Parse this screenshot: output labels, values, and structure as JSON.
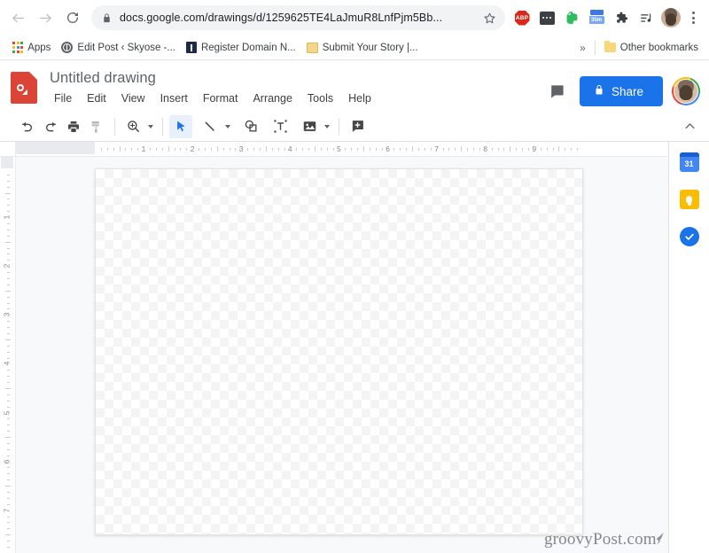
{
  "browser": {
    "nav": {
      "back_label": "Back",
      "forward_label": "Forward",
      "reload_label": "Reload"
    },
    "omnibox": {
      "url": "docs.google.com/drawings/d/1259625TE4LaJmuR8LnfPjm5Bb...",
      "lock_label": "Secure",
      "star_label": "Bookmark this tab"
    },
    "extensions": [
      {
        "name": "adblock-plus-extension",
        "label": "ABP"
      },
      {
        "name": "dots-extension",
        "label": ""
      },
      {
        "name": "evernote-extension",
        "label": ""
      },
      {
        "name": "timer-extension",
        "label": "35m"
      },
      {
        "name": "extensions-puzzle",
        "label": ""
      },
      {
        "name": "media-playlist",
        "label": ""
      }
    ],
    "profile_label": "Profile",
    "menu_label": "Customize and control Google Chrome",
    "bookmarks": [
      {
        "name": "bookmark-apps",
        "label": "Apps",
        "icon": "apps-grid-icon"
      },
      {
        "name": "bookmark-edit-post",
        "label": "Edit Post ‹ Skyose -...",
        "icon": "globe-icon"
      },
      {
        "name": "bookmark-register-domain",
        "label": "Register Domain N...",
        "icon": "blue-square-icon"
      },
      {
        "name": "bookmark-submit-story",
        "label": "Submit Your Story |...",
        "icon": "yellow-page-icon"
      }
    ],
    "overflow_label": "»",
    "other_bookmarks_label": "Other bookmarks"
  },
  "app": {
    "doc_icon_name": "google-drawings-icon",
    "title": "Untitled drawing",
    "menus": [
      "File",
      "Edit",
      "View",
      "Insert",
      "Format",
      "Arrange",
      "Tools",
      "Help"
    ],
    "comment_label": "Open comment history",
    "share_label": "Share",
    "share_color": "#1a73e8",
    "avatar_label": "Google Account",
    "toolbar": [
      {
        "name": "undo-button",
        "icon": "undo-icon",
        "state": "enabled",
        "caret": false
      },
      {
        "name": "redo-button",
        "icon": "redo-icon",
        "state": "enabled",
        "caret": false
      },
      {
        "name": "print-button",
        "icon": "print-icon",
        "state": "enabled",
        "caret": false
      },
      {
        "name": "paint-format-button",
        "icon": "paint-format-icon",
        "state": "disabled",
        "caret": false
      },
      {
        "name": "zoom-button",
        "icon": "zoom-in-icon",
        "state": "enabled",
        "caret": true
      },
      {
        "name": "select-tool-button",
        "icon": "cursor-arrow-icon",
        "state": "active",
        "caret": false
      },
      {
        "name": "line-tool-button",
        "icon": "line-icon",
        "state": "enabled",
        "caret": true
      },
      {
        "name": "shape-tool-button",
        "icon": "shape-icon",
        "state": "enabled",
        "caret": false
      },
      {
        "name": "text-box-button",
        "icon": "text-box-icon",
        "state": "enabled",
        "caret": false
      },
      {
        "name": "image-button",
        "icon": "image-icon",
        "state": "enabled",
        "caret": true
      },
      {
        "name": "add-comment-button",
        "icon": "comment-plus-icon",
        "state": "enabled",
        "caret": false
      }
    ],
    "collapse_label": "Hide the menus"
  },
  "workspace": {
    "ruler_h_numbers": [
      "1",
      "2",
      "3",
      "4",
      "5",
      "6",
      "7",
      "8",
      "9"
    ],
    "ruler_v_numbers": [
      "1",
      "2",
      "3",
      "4",
      "5",
      "6",
      "7"
    ],
    "canvas_label": "Drawing canvas",
    "watermark": "groovyPost.com"
  },
  "side_panel": [
    {
      "name": "google-calendar-icon",
      "label": "31",
      "color": "#4285f4"
    },
    {
      "name": "google-keep-icon",
      "label": "",
      "color": "#fbbc04"
    },
    {
      "name": "google-tasks-icon",
      "label": "",
      "color": "#1a73e8"
    }
  ]
}
